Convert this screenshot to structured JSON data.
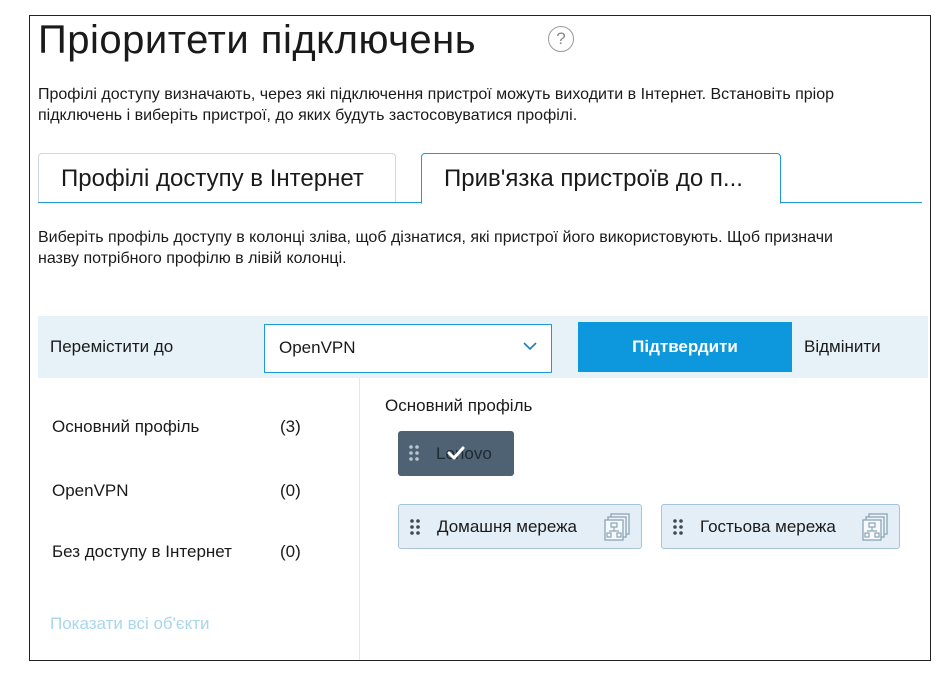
{
  "page": {
    "title": "Пріоритети підключень",
    "help_icon": "?",
    "intro_line1": "Профілі доступу визначають, через які підключення пристрої можуть виходити в Інтернет. Встановіть пріор",
    "intro_line2": "підключень і виберіть пристрої, до яких будуть застосовуватися профілі."
  },
  "tabs": [
    {
      "label": "Профілі доступу в Інтернет",
      "active": false
    },
    {
      "label": "Прив'язка пристроїв до п...",
      "active": true
    }
  ],
  "description": {
    "line1": "Виберіть профіль доступу в колонці зліва, щоб дізнатися, які пристрої його використовують. Щоб призначи",
    "line2": "назву потрібного профілю в лівій колонці."
  },
  "move_bar": {
    "label": "Перемістити до",
    "select_value": "OpenVPN",
    "confirm_label": "Підтвердити",
    "cancel_label": "Відмінити"
  },
  "profiles": [
    {
      "name": "Основний профіль",
      "count": "(3)"
    },
    {
      "name": "OpenVPN",
      "count": "(0)"
    },
    {
      "name": "Без доступу в Інтернет",
      "count": "(0)"
    }
  ],
  "show_all": "Показати всі об'єкти",
  "group": {
    "title": "Основний профіль",
    "devices": [
      {
        "label": "Lenovo",
        "selected": true,
        "icon": "check-icon"
      },
      {
        "label": "Домашня мережа",
        "selected": false,
        "icon": "network-icon"
      },
      {
        "label": "Гостьова мережа",
        "selected": false,
        "icon": "network-icon"
      }
    ]
  },
  "colors": {
    "accent": "#0d97dc",
    "bar_bg": "#e7f1f8",
    "chip_selected": "#4e6273",
    "chip_bg": "#e3eef6",
    "link_light": "#a7d6ef"
  }
}
